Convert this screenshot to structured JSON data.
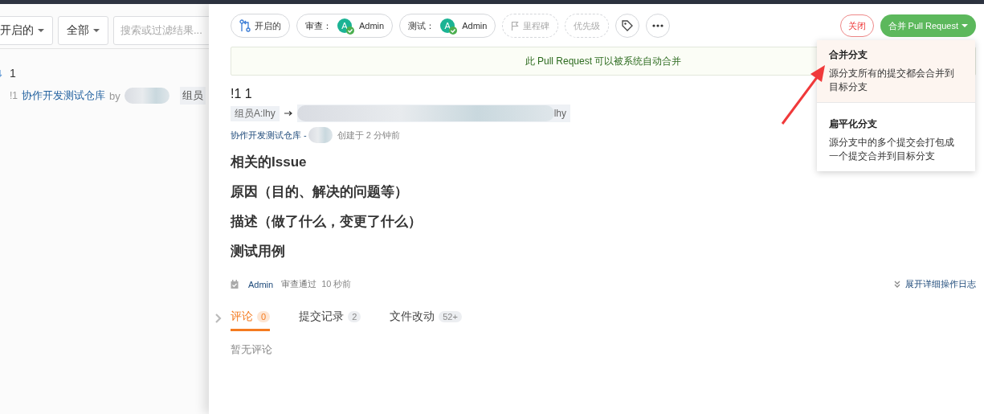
{
  "left_panel": {
    "filters": [
      {
        "label": "开启的"
      },
      {
        "label": "全部"
      }
    ],
    "search": {
      "placeholder": "搜索或过滤结果..."
    },
    "group": {
      "count": "1"
    },
    "items": [
      {
        "number": "!1",
        "title": "协作开发测试仓库",
        "by": "by",
        "tag": "组员"
      }
    ]
  },
  "drawer": {
    "toolbar": {
      "status": "开启的",
      "assignees": [
        {
          "label": "审查：",
          "initial": "A",
          "name": "Admin"
        },
        {
          "label": "测试：",
          "initial": "A",
          "name": "Admin"
        }
      ],
      "milestone": "里程碑",
      "priority": "优先级"
    },
    "close_button": "关闭",
    "merge_button": "合并 Pull Request",
    "merge_notice": "此 Pull Request 可以被系统自动合并",
    "title": "!1 1",
    "source_branch": "组员A:lhy",
    "target_branch": "lhy",
    "repo": "协作开发测试仓库 -",
    "created": "创建于 2 分钟前",
    "sections": [
      "相关的Issue",
      "原因（目的、解决的问题等）",
      "描述（做了什么，变更了什么）",
      "测试用例"
    ],
    "activity": {
      "user": "Admin",
      "action": "审查通过",
      "time": "10 秒前"
    },
    "expand_log": "展开详细操作日志",
    "tabs": [
      {
        "label": "评论",
        "count": "0",
        "selected": true
      },
      {
        "label": "提交记录",
        "count": "2",
        "selected": false
      },
      {
        "label": "文件改动",
        "count": "52+",
        "selected": false
      }
    ],
    "empty_comments": "暂无评论"
  },
  "merge_menu": {
    "items": [
      {
        "title": "合并分支",
        "description": "源分支所有的提交都会合并到目标分支",
        "selected": true
      },
      {
        "title": "扁平化分支",
        "description": "源分支中的多个提交会打包成一个提交合并到目标分支",
        "selected": false
      }
    ]
  }
}
